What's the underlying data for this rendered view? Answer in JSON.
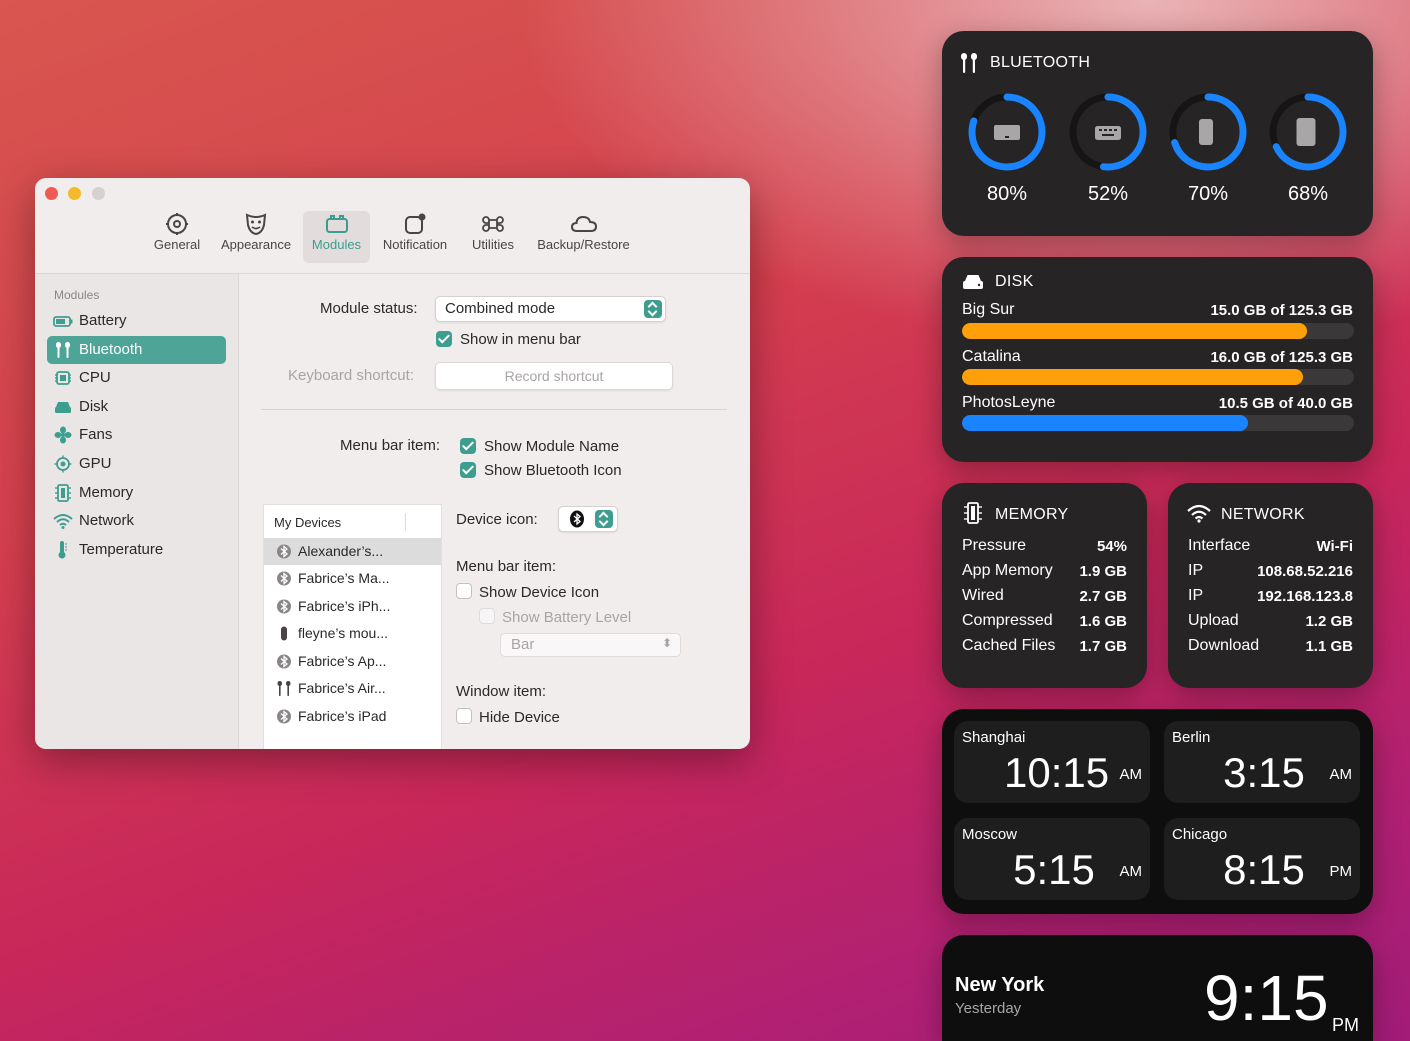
{
  "toolbar": {
    "tabs": [
      {
        "label": "General",
        "icon": "gear-icon"
      },
      {
        "label": "Appearance",
        "icon": "mask-icon"
      },
      {
        "label": "Modules",
        "icon": "modules-icon"
      },
      {
        "label": "Notification",
        "icon": "notification-icon"
      },
      {
        "label": "Utilities",
        "icon": "command-icon"
      },
      {
        "label": "Backup/Restore",
        "icon": "cloud-icon"
      }
    ],
    "selected": "Modules"
  },
  "sidebar": {
    "heading": "Modules",
    "items": [
      {
        "label": "Battery",
        "icon": "battery-icon"
      },
      {
        "label": "Bluetooth",
        "icon": "airpods-icon"
      },
      {
        "label": "CPU",
        "icon": "cpu-icon"
      },
      {
        "label": "Disk",
        "icon": "disk-icon"
      },
      {
        "label": "Fans",
        "icon": "fan-icon"
      },
      {
        "label": "GPU",
        "icon": "gpu-icon"
      },
      {
        "label": "Memory",
        "icon": "memory-icon"
      },
      {
        "label": "Network",
        "icon": "wifi-icon"
      },
      {
        "label": "Temperature",
        "icon": "thermometer-icon"
      }
    ],
    "selected": "Bluetooth"
  },
  "settings": {
    "module_status_label": "Module status:",
    "module_status_value": "Combined mode",
    "show_in_menu_bar": "Show in menu bar",
    "keyboard_shortcut_label": "Keyboard shortcut:",
    "record_shortcut": "Record shortcut",
    "menu_bar_item_label": "Menu bar item:",
    "show_module_name": "Show Module Name",
    "show_bluetooth_icon": "Show Bluetooth Icon",
    "device_icon_label": "Device icon:",
    "device_menu_bar_item_label": "Menu bar item:",
    "show_device_icon": "Show Device Icon",
    "show_battery_level": "Show Battery Level",
    "battery_style_value": "Bar",
    "window_item_label": "Window item:",
    "hide_device": "Hide Device"
  },
  "devices": {
    "heading": "My Devices",
    "items": [
      {
        "label": "Alexander’s...",
        "icon": "bluetooth-icon"
      },
      {
        "label": "Fabrice’s Ma...",
        "icon": "bluetooth-icon"
      },
      {
        "label": "Fabrice’s iPh...",
        "icon": "bluetooth-icon"
      },
      {
        "label": "fleyne’s mou...",
        "icon": "mouse-icon"
      },
      {
        "label": "Fabrice’s Ap...",
        "icon": "bluetooth-icon"
      },
      {
        "label": "Fabrice’s Air...",
        "icon": "airpods-icon"
      },
      {
        "label": "Fabrice’s iPad",
        "icon": "bluetooth-icon"
      }
    ]
  },
  "bluetooth_widget": {
    "title": "BLUETOOTH",
    "devices": [
      {
        "icon": "laptop-icon",
        "percent_label": "80%",
        "level": 0.8
      },
      {
        "icon": "keyboard-icon",
        "percent_label": "52%",
        "level": 0.52
      },
      {
        "icon": "phone-icon",
        "percent_label": "70%",
        "level": 0.7
      },
      {
        "icon": "tablet-icon",
        "percent_label": "68%",
        "level": 0.68
      }
    ],
    "ring_color": "#1a84ff"
  },
  "disk_widget": {
    "title": "DISK",
    "volumes": [
      {
        "name": "Big Sur",
        "usage": "15.0 GB of 125.3 GB",
        "level": 0.88,
        "color": "#ff9f0a"
      },
      {
        "name": "Catalina",
        "usage": "16.0 GB of 125.3 GB",
        "level": 0.87,
        "color": "#ff9f0a"
      },
      {
        "name": "PhotosLeyne",
        "usage": "10.5 GB of 40.0 GB",
        "level": 0.73,
        "color": "#1a84ff"
      }
    ]
  },
  "memory_widget": {
    "title": "MEMORY",
    "rows": [
      {
        "label": "Pressure",
        "value": "54%"
      },
      {
        "label": "App Memory",
        "value": "1.9 GB"
      },
      {
        "label": "Wired",
        "value": "2.7 GB"
      },
      {
        "label": "Compressed",
        "value": "1.6 GB"
      },
      {
        "label": "Cached Files",
        "value": "1.7 GB"
      }
    ]
  },
  "network_widget": {
    "title": "NETWORK",
    "rows": [
      {
        "label": "Interface",
        "value": "Wi-Fi"
      },
      {
        "label": "IP",
        "value": "108.68.52.216"
      },
      {
        "label": "IP",
        "value": "192.168.123.8"
      },
      {
        "label": "Upload",
        "value": "1.2 GB"
      },
      {
        "label": "Download",
        "value": "1.1 GB"
      }
    ]
  },
  "world_clock": {
    "clocks": [
      {
        "city": "Shanghai",
        "time": "10:15",
        "ampm": "AM"
      },
      {
        "city": "Berlin",
        "time": "3:15",
        "ampm": "AM"
      },
      {
        "city": "Moscow",
        "time": "5:15",
        "ampm": "AM"
      },
      {
        "city": "Chicago",
        "time": "8:15",
        "ampm": "PM"
      }
    ]
  },
  "local_clock": {
    "city": "New York",
    "day": "Yesterday",
    "time": "9:15",
    "ampm": "PM"
  }
}
